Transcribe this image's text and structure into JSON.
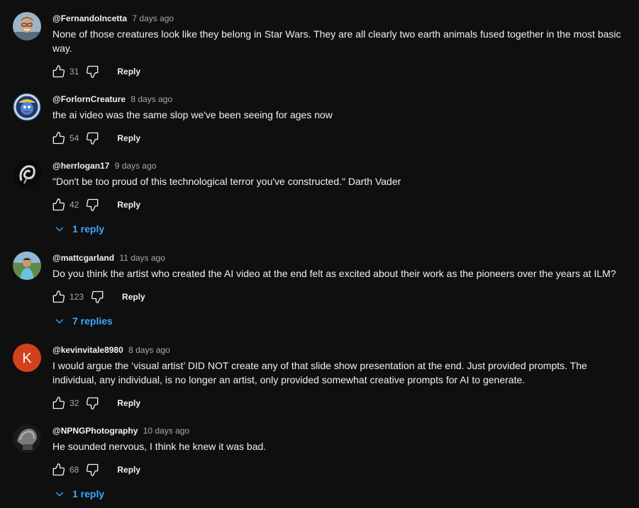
{
  "labels": {
    "reply": "Reply"
  },
  "comments": [
    {
      "author": "@FernandoIncetta",
      "time": "7 days ago",
      "text": "None of those creatures look like they belong in Star Wars. They are all clearly two earth animals fused together in the most basic way.",
      "likes": "31",
      "replies": null,
      "avatar": "person-photo"
    },
    {
      "author": "@ForlornCreature",
      "time": "8 days ago",
      "text": "the ai video was the same slop we've been seeing for ages now",
      "likes": "54",
      "replies": null,
      "avatar": "cartoon-character"
    },
    {
      "author": "@herrlogan17",
      "time": "9 days ago",
      "text": "\"Don't be too proud of this technological terror you've constructed.\" Darth Vader",
      "likes": "42",
      "replies": "1 reply",
      "avatar": "dark-swirl"
    },
    {
      "author": "@mattcgarland",
      "time": "11 days ago",
      "text": "Do you think the artist who created the AI video at the end felt as excited about their work as the pioneers over the years at ILM?",
      "likes": "123",
      "replies": "7 replies",
      "avatar": "person-outdoors"
    },
    {
      "author": "@kevinvitale8980",
      "time": "8 days ago",
      "text": "I would argue the ‘visual artist’ DID NOT create any of that slide show presentation at the end. Just provided prompts. The individual, any individual, is no longer an artist, only provided somewhat creative prompts for AI to generate.",
      "likes": "32",
      "replies": null,
      "avatar": "letter-avatar",
      "avatar_letter": "K",
      "avatar_color": "#d3401d"
    },
    {
      "author": "@NPNGPhotography",
      "time": "10 days ago",
      "text": "He sounded nervous, I think he knew it was bad.",
      "likes": "68",
      "replies": "1 reply",
      "avatar": "grey-object"
    }
  ],
  "colors": {
    "background": "#0f0f0f",
    "text": "#f1f1f1",
    "secondary": "#aaaaaa",
    "link": "#3ea6ff"
  }
}
